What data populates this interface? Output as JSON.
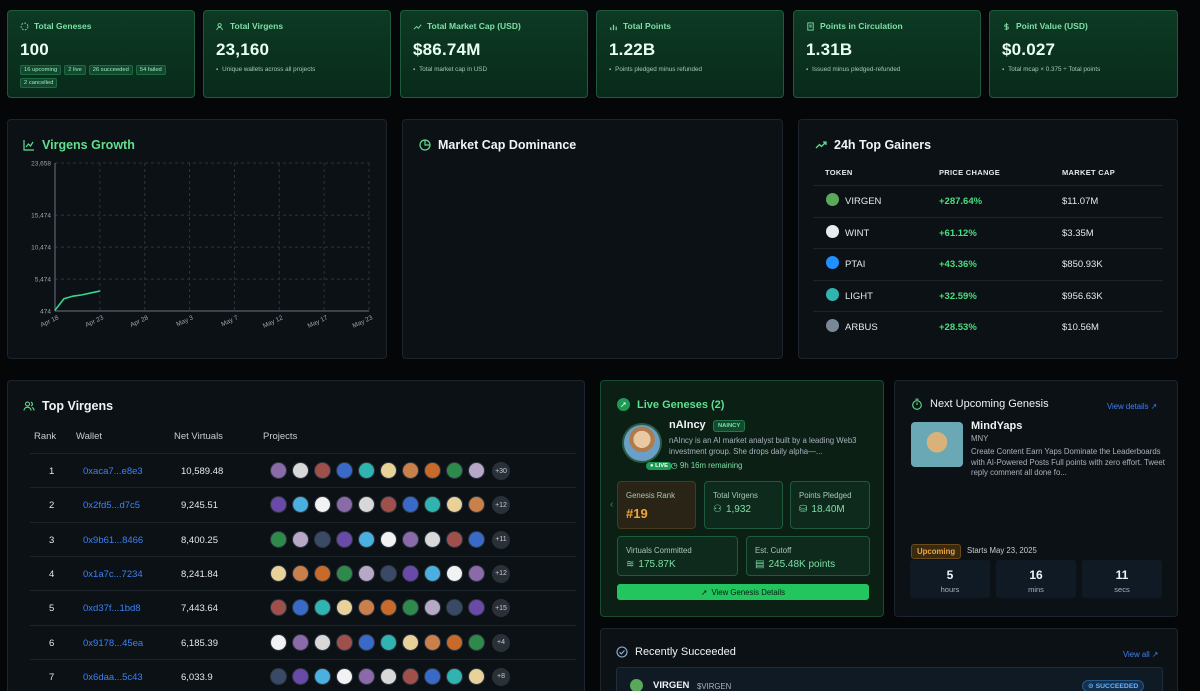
{
  "stats": [
    {
      "icon": "loader-icon",
      "title": "Total Geneses",
      "value": "100",
      "chips": [
        "16 upcoming",
        "2 live",
        "26 succeeded",
        "54 failed",
        "2 cancelled"
      ]
    },
    {
      "icon": "users-icon",
      "title": "Total Virgens",
      "value": "23,160",
      "sub": "Unique wallets across all projects"
    },
    {
      "icon": "trending-up-icon",
      "title": "Total Market Cap (USD)",
      "value": "$86.74M",
      "sub": "Total market cap in USD"
    },
    {
      "icon": "bar-chart-icon",
      "title": "Total Points",
      "value": "1.22B",
      "sub": "Points pledged minus refunded"
    },
    {
      "icon": "receipt-icon",
      "title": "Points in Circulation",
      "value": "1.31B",
      "sub": "Issued minus pledged-refunded"
    },
    {
      "icon": "dollar-icon",
      "title": "Point Value (USD)",
      "value": "$0.027",
      "sub": "Total mcap × 0.375 ÷ Total points"
    }
  ],
  "growth": {
    "title": "Virgens Growth",
    "chart_data": {
      "type": "line",
      "x_ticks": [
        "Apr 18",
        "Apr 23",
        "Apr 28",
        "May 3",
        "May 7",
        "May 12",
        "May 17",
        "May 23"
      ],
      "y_ticks": [
        "474",
        "5,474",
        "10,474",
        "15,474",
        "23,658"
      ],
      "ylim": [
        474,
        23658
      ],
      "grid": true,
      "series": [
        {
          "x": [
            "Apr 18",
            "Apr 19",
            "Apr 20",
            "Apr 21",
            "Apr 22",
            "Apr 23"
          ],
          "values": [
            600,
            2400,
            2800,
            3000,
            3300,
            3600
          ]
        }
      ]
    }
  },
  "dominance": {
    "title": "Market Cap Dominance"
  },
  "gainers": {
    "title": "24h Top Gainers",
    "headers": [
      "TOKEN",
      "PRICE CHANGE",
      "MARKET CAP"
    ],
    "rows": [
      {
        "token": "VIRGEN",
        "change": "+287.64%",
        "cap": "$11.07M",
        "color": "#5aa85a"
      },
      {
        "token": "WINT",
        "change": "+61.12%",
        "cap": "$3.35M",
        "color": "#e8ecf2"
      },
      {
        "token": "PTAI",
        "change": "+43.36%",
        "cap": "$850.93K",
        "color": "#1e90ff"
      },
      {
        "token": "LIGHT",
        "change": "+32.59%",
        "cap": "$956.63K",
        "color": "#2fb4b0"
      },
      {
        "token": "ARBUS",
        "change": "+28.53%",
        "cap": "$10.56M",
        "color": "#7a8896"
      }
    ]
  },
  "virgens": {
    "title": "Top Virgens",
    "headers": [
      "Rank",
      "Wallet",
      "Net Virtuals",
      "Projects"
    ],
    "rows": [
      {
        "rank": "1",
        "wallet": "0xaca7...e8e3",
        "net": "10,589.48",
        "more": "+30"
      },
      {
        "rank": "2",
        "wallet": "0x2fd5...d7c5",
        "net": "9,245.51",
        "more": "+12"
      },
      {
        "rank": "3",
        "wallet": "0x9b61...8466",
        "net": "8,400.25",
        "more": "+11"
      },
      {
        "rank": "4",
        "wallet": "0x1a7c...7234",
        "net": "8,241.84",
        "more": "+12"
      },
      {
        "rank": "5",
        "wallet": "0xd37f...1bd8",
        "net": "7,443.64",
        "more": "+15"
      },
      {
        "rank": "6",
        "wallet": "0x9178...45ea",
        "net": "6,185.39",
        "more": "+4"
      },
      {
        "rank": "7",
        "wallet": "0x6daa...5c43",
        "net": "6,033.9",
        "more": "+8"
      }
    ]
  },
  "live": {
    "title": "Live Geneses (2)",
    "name": "nAIncy",
    "ticker": "NAINCY",
    "desc": "nAIncy is an AI market analyst built by a leading Web3 investment group. She drops daily alpha—...",
    "live_badge": "LIVE",
    "remaining": "9h 16m remaining",
    "rank_label": "Genesis Rank",
    "rank": "#19",
    "virgens_label": "Total Virgens",
    "virgens": "1,932",
    "points_label": "Points Pledged",
    "points": "18.40M",
    "committed_label": "Virtuals Committed",
    "committed": "175.87K",
    "cutoff_label": "Est. Cutoff",
    "cutoff": "245.48K points",
    "button": "View Genesis Details"
  },
  "upcoming": {
    "title": "Next Upcoming Genesis",
    "link": "View details",
    "name": "MindYaps",
    "ticker": "MNY",
    "desc": "Create Content Earn Yaps Dominate the Leaderboards with AI-Powered Posts Full points with zero effort. Tweet reply comment all done fo...",
    "badge": "Upcoming",
    "starts": "Starts May 23, 2025",
    "countdown": [
      {
        "n": "5",
        "u": "hours"
      },
      {
        "n": "16",
        "u": "mins"
      },
      {
        "n": "11",
        "u": "secs"
      }
    ]
  },
  "succeeded": {
    "title": "Recently Succeeded",
    "link": "View all",
    "name": "VIRGEN",
    "ticker": "$VIRGEN",
    "badge": "SUCCEEDED"
  }
}
